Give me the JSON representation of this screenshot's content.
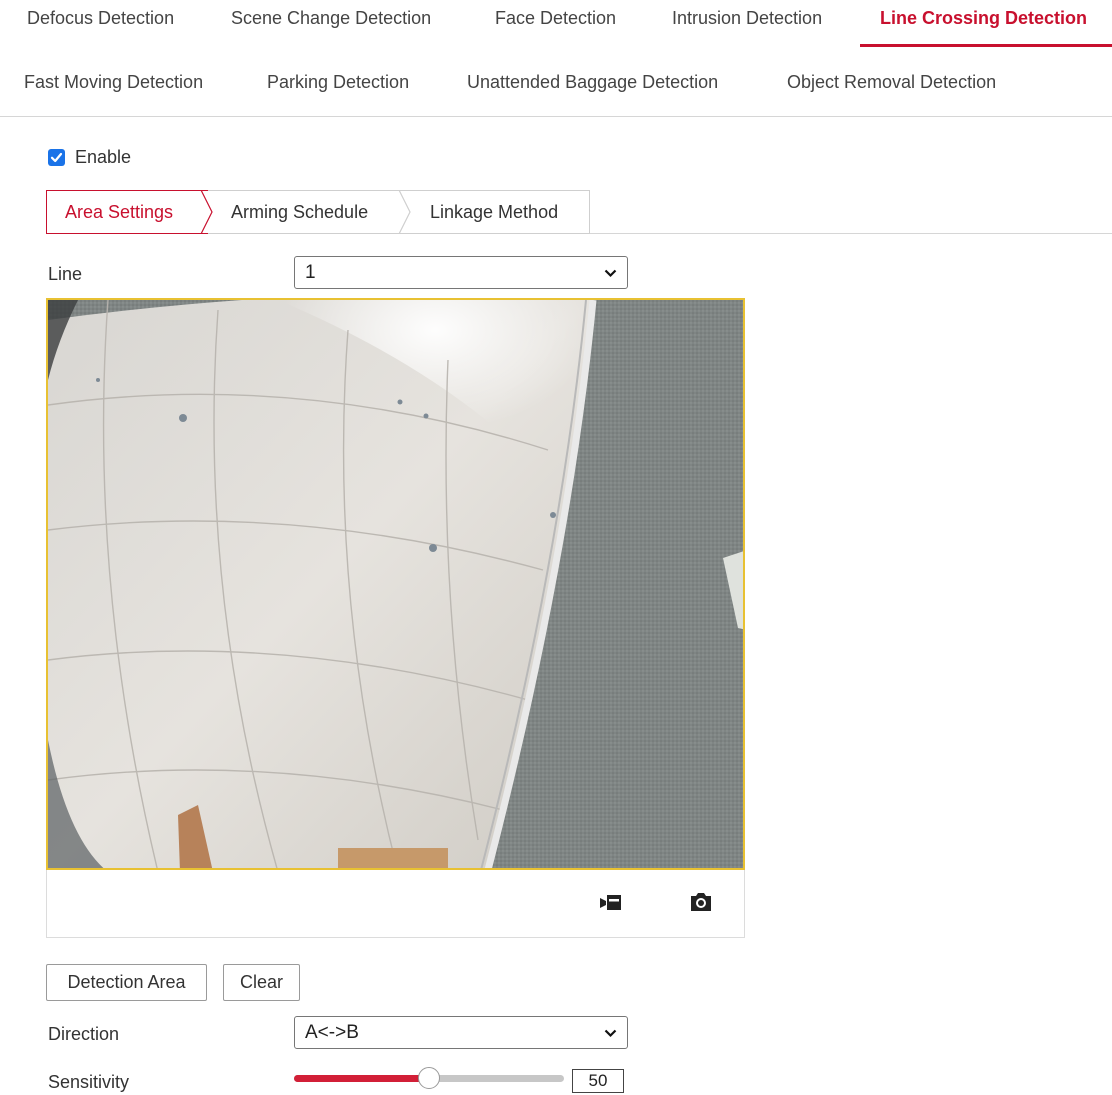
{
  "tabs_row1": [
    {
      "label": "Defocus Detection",
      "active": false
    },
    {
      "label": "Scene Change Detection",
      "active": false
    },
    {
      "label": "Face Detection",
      "active": false
    },
    {
      "label": "Intrusion Detection",
      "active": false
    },
    {
      "label": "Line Crossing Detection",
      "active": true
    }
  ],
  "tabs_row2": [
    {
      "label": "Fast Moving Detection"
    },
    {
      "label": "Parking Detection"
    },
    {
      "label": "Unattended Baggage Detection"
    },
    {
      "label": "Object Removal Detection"
    }
  ],
  "enable": {
    "label": "Enable",
    "checked": true
  },
  "subtabs": [
    {
      "label": "Area Settings",
      "active": true
    },
    {
      "label": "Arming Schedule",
      "active": false
    },
    {
      "label": "Linkage Method",
      "active": false
    }
  ],
  "line": {
    "label": "Line",
    "value": "1"
  },
  "video_toolbar": {
    "icons": [
      "record-icon",
      "snapshot-icon"
    ]
  },
  "buttons": {
    "detection_area": "Detection Area",
    "clear": "Clear"
  },
  "direction": {
    "label": "Direction",
    "value": "A<->B"
  },
  "sensitivity": {
    "label": "Sensitivity",
    "value": "50",
    "level_fraction": 0.5
  },
  "colors": {
    "accent": "#c8102e",
    "checkbox": "#1a73e8",
    "video_border": "#e8c132"
  }
}
